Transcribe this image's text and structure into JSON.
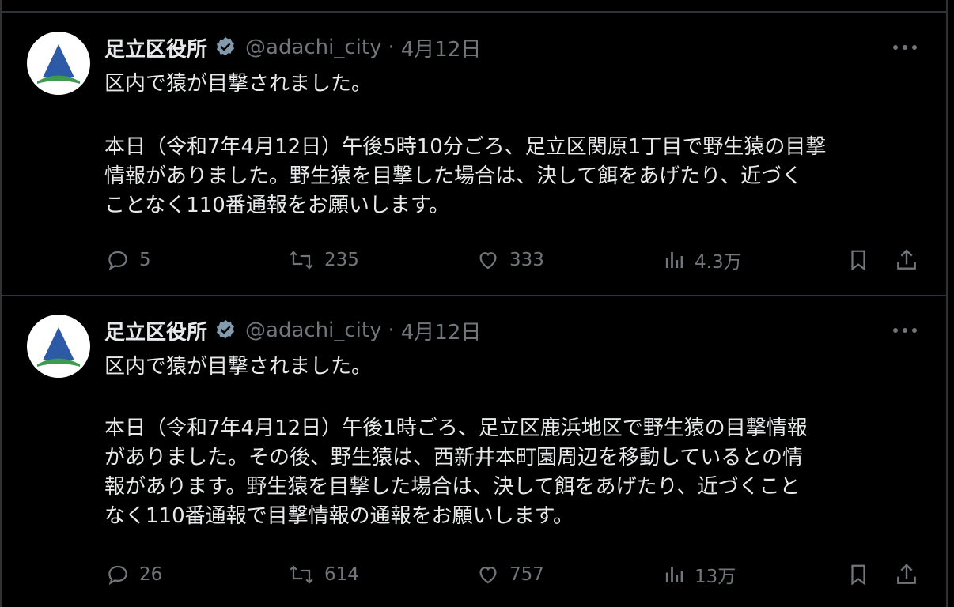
{
  "tweets": [
    {
      "name": "足立区役所",
      "handle": "@adachi_city",
      "separator": "·",
      "date": "4月12日",
      "line1": "区内で猿が目撃されました。",
      "line2": "本日（令和7年4月12日）午後5時10分ごろ、足立区関原1丁目で野生猿の目撃\n情報がありました。野生猿を目撃した場合は、決して餌をあげたり、近づく\nことなく110番通報をお願いします。",
      "replies": "5",
      "reposts": "235",
      "likes": "333",
      "views": "4.3万"
    },
    {
      "name": "足立区役所",
      "handle": "@adachi_city",
      "separator": "·",
      "date": "4月12日",
      "line1": "区内で猿が目撃されました。",
      "line2": "本日（令和7年4月12日）午後1時ごろ、足立区鹿浜地区で野生猿の目撃情報\nがありました。その後、野生猿は、西新井本町園周辺を移動しているとの情\n報があります。野生猿を目撃した場合は、決して餌をあげたり、近づくこと\nなく110番通報で目撃情報の通報をお願いします。",
      "replies": "26",
      "reposts": "614",
      "likes": "757",
      "views": "13万"
    }
  ],
  "icons": {
    "avatar": "adachi-logo",
    "verified": "verified-badge-icon",
    "more": "more-icon",
    "reply": "reply-icon",
    "repost": "repost-icon",
    "like": "like-icon",
    "views": "views-icon",
    "bookmark": "bookmark-icon",
    "share": "share-icon"
  },
  "colors": {
    "background": "#000000",
    "text": "#e7e9ea",
    "muted": "#71767b",
    "border": "#2f3336",
    "logo_blue": "#2d5aa6",
    "logo_green": "#3f9a4f"
  }
}
